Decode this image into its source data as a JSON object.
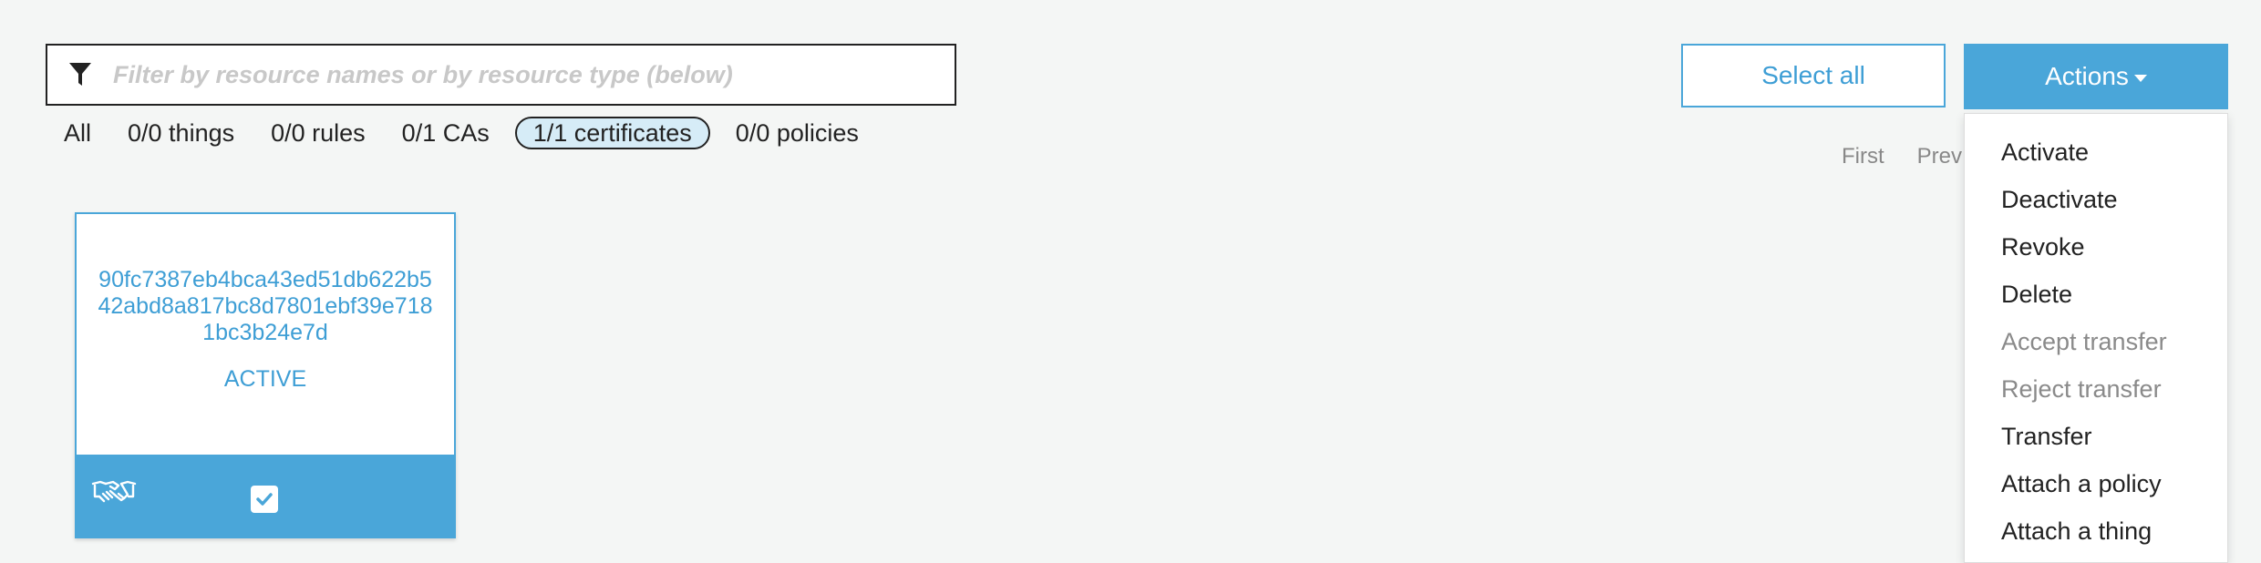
{
  "search": {
    "placeholder": "Filter by resource names or by resource type (below)"
  },
  "type_filters": [
    {
      "label": "All"
    },
    {
      "label": "0/0 things"
    },
    {
      "label": "0/0 rules"
    },
    {
      "label": "0/1 CAs"
    },
    {
      "label": "1/1 certificates"
    },
    {
      "label": "0/0 policies"
    }
  ],
  "toolbar": {
    "select_all_label": "Select all",
    "actions_label": "Actions"
  },
  "pagination": {
    "first_label": "First",
    "prev_label": "Prev"
  },
  "actions_menu": {
    "items": [
      {
        "label": "Activate"
      },
      {
        "label": "Deactivate"
      },
      {
        "label": "Revoke"
      },
      {
        "label": "Delete"
      },
      {
        "label": "Accept transfer"
      },
      {
        "label": "Reject transfer"
      },
      {
        "label": "Transfer"
      },
      {
        "label": "Attach a policy"
      },
      {
        "label": "Attach a thing"
      }
    ]
  },
  "card": {
    "certificate_id": "90fc7387eb4bca43ed51db622b542abd8a817bc8d7801ebf39e7181bc3b24e7d",
    "status": "ACTIVE"
  },
  "colors": {
    "accent": "#4aa6d9",
    "accent_text": "#3e9ed5",
    "background": "#f4f6f5"
  },
  "icons": {
    "filter": "filter-icon",
    "handshake": "handshake-icon",
    "checkbox": "checkbox-checked-icon",
    "caret": "caret-down-icon"
  }
}
